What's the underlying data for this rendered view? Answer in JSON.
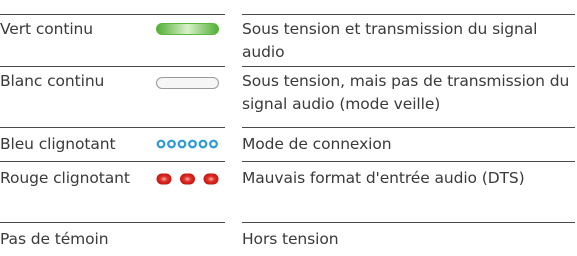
{
  "rows": [
    {
      "state": "Vert continu",
      "description": "Sous tension et transmission du signal audio",
      "indicator": "solid-green-bar-icon"
    },
    {
      "state": "Blanc continu",
      "description": "Sous tension, mais pas de transmission du signal audio (mode veille)",
      "indicator": "solid-white-bar-icon"
    },
    {
      "state": "Bleu clignotant",
      "description": "Mode de connexion",
      "indicator": "blinking-blue-dots-icon"
    },
    {
      "state": "Rouge clignotant",
      "description": "Mauvais format d'entrée audio (DTS)",
      "indicator": "blinking-red-dots-icon"
    },
    {
      "state": "Pas de témoin",
      "description": "Hors tension",
      "indicator": "none"
    }
  ],
  "colors": {
    "green": "#6cc24a",
    "white": "#f4f4f4",
    "blue": "#3aa3d8",
    "red": "#d8231f",
    "rule": "#4a4a4a",
    "text": "#3a3a3a"
  }
}
